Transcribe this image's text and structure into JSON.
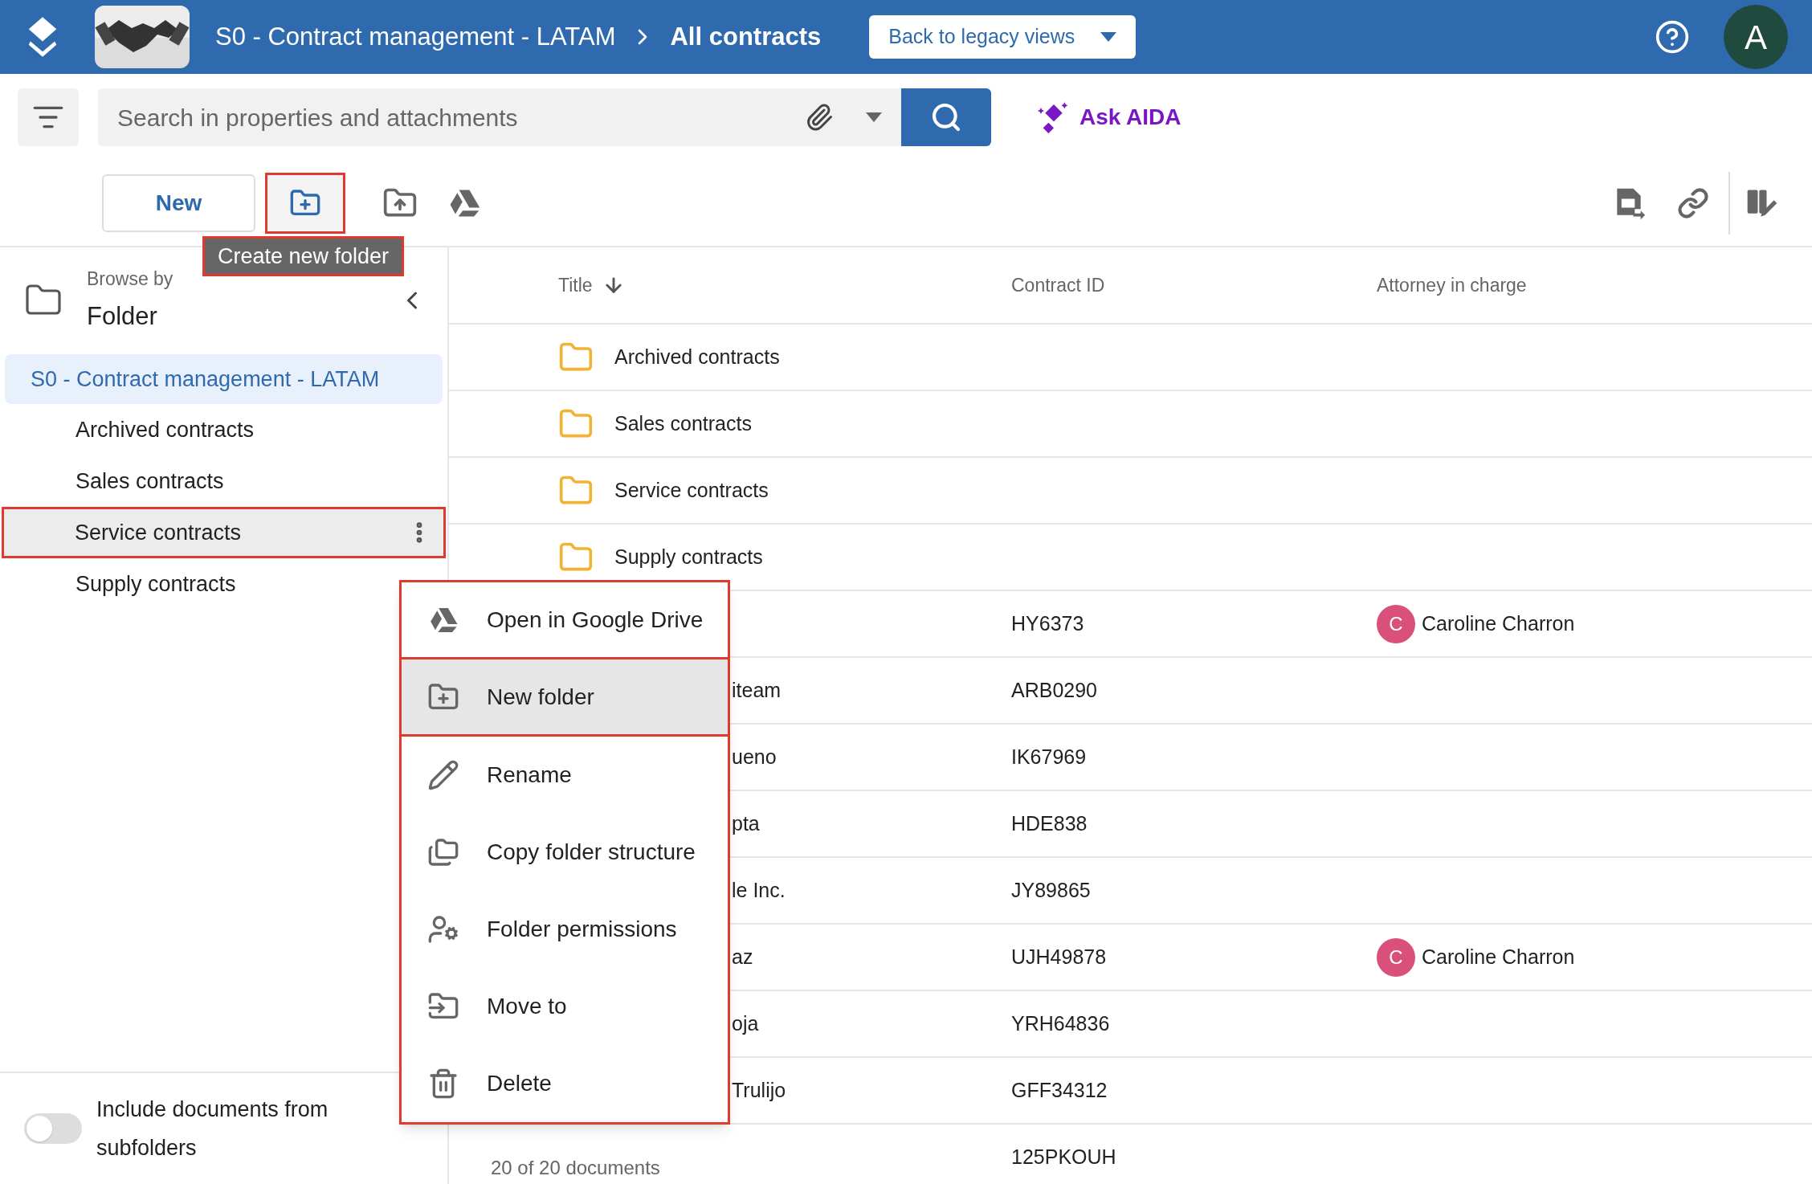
{
  "header": {
    "breadcrumb": [
      "S0 - Contract management - LATAM",
      "All contracts"
    ],
    "legacy_button": "Back to legacy views",
    "avatar": "A"
  },
  "search": {
    "placeholder": "Search in properties and attachments",
    "ask_button": "Ask AIDA"
  },
  "toolbar": {
    "new_button": "New",
    "create_folder_outlined": true,
    "tooltip": {
      "text": "Create new folder",
      "outlined": true
    }
  },
  "sidebar": {
    "browse_by": "Browse by",
    "mode": "Folder",
    "tree": {
      "label": "S0 - Contract management - LATAM",
      "selected": true,
      "children": [
        {
          "label": "Archived contracts",
          "selected": false,
          "highlighted": false,
          "outlined": false
        },
        {
          "label": "Sales contracts",
          "selected": false,
          "highlighted": false,
          "outlined": false
        },
        {
          "label": "Service contracts",
          "selected": false,
          "highlighted": true,
          "outlined": true
        },
        {
          "label": "Supply contracts",
          "selected": false,
          "highlighted": false,
          "outlined": false
        }
      ]
    },
    "include_subfolders": {
      "label": "Include documents from subfolders",
      "on": false
    }
  },
  "table": {
    "columns": [
      "Title",
      "Contract ID",
      "Attorney in charge"
    ],
    "rows": [
      {
        "kind": "folder",
        "title": "Archived contracts"
      },
      {
        "kind": "folder",
        "title": "Sales contracts"
      },
      {
        "kind": "folder",
        "title": "Service contracts"
      },
      {
        "kind": "folder",
        "title": "Supply contracts"
      },
      {
        "kind": "document",
        "contract_id": "HY6373",
        "attorney": {
          "initial": "C",
          "name": "Caroline Charron",
          "color": "#d9507b"
        }
      },
      {
        "kind": "document",
        "title": "iteam",
        "contract_id": "ARB0290"
      },
      {
        "kind": "document",
        "title": "ueno",
        "contract_id": "IK67969"
      },
      {
        "kind": "document",
        "title": "pta",
        "contract_id": "HDE838"
      },
      {
        "kind": "document",
        "title": "le Inc.",
        "contract_id": "JY89865"
      },
      {
        "kind": "document",
        "title": "az",
        "contract_id": "UJH49878",
        "attorney": {
          "initial": "C",
          "name": "Caroline Charron",
          "color": "#d9507b"
        }
      },
      {
        "kind": "document",
        "title": "oja",
        "contract_id": "YRH64836"
      },
      {
        "kind": "document",
        "title": "Trulijo",
        "contract_id": "GFF34312"
      },
      {
        "kind": "document",
        "contract_id": "125PKOUH"
      }
    ],
    "footer": "20 of 20 documents"
  },
  "context_menu": {
    "items": [
      {
        "label": "Open in Google Drive",
        "selected": false,
        "outlined": true
      },
      {
        "label": "New folder",
        "selected": true,
        "outlined": true
      },
      {
        "label": "Rename",
        "selected": false,
        "outlined": false
      },
      {
        "label": "Copy folder structure",
        "selected": false,
        "outlined": false
      },
      {
        "label": "Folder permissions",
        "selected": false,
        "outlined": false
      },
      {
        "label": "Move to",
        "selected": false,
        "outlined": false
      },
      {
        "label": "Delete",
        "selected": false,
        "outlined": false
      }
    ]
  }
}
